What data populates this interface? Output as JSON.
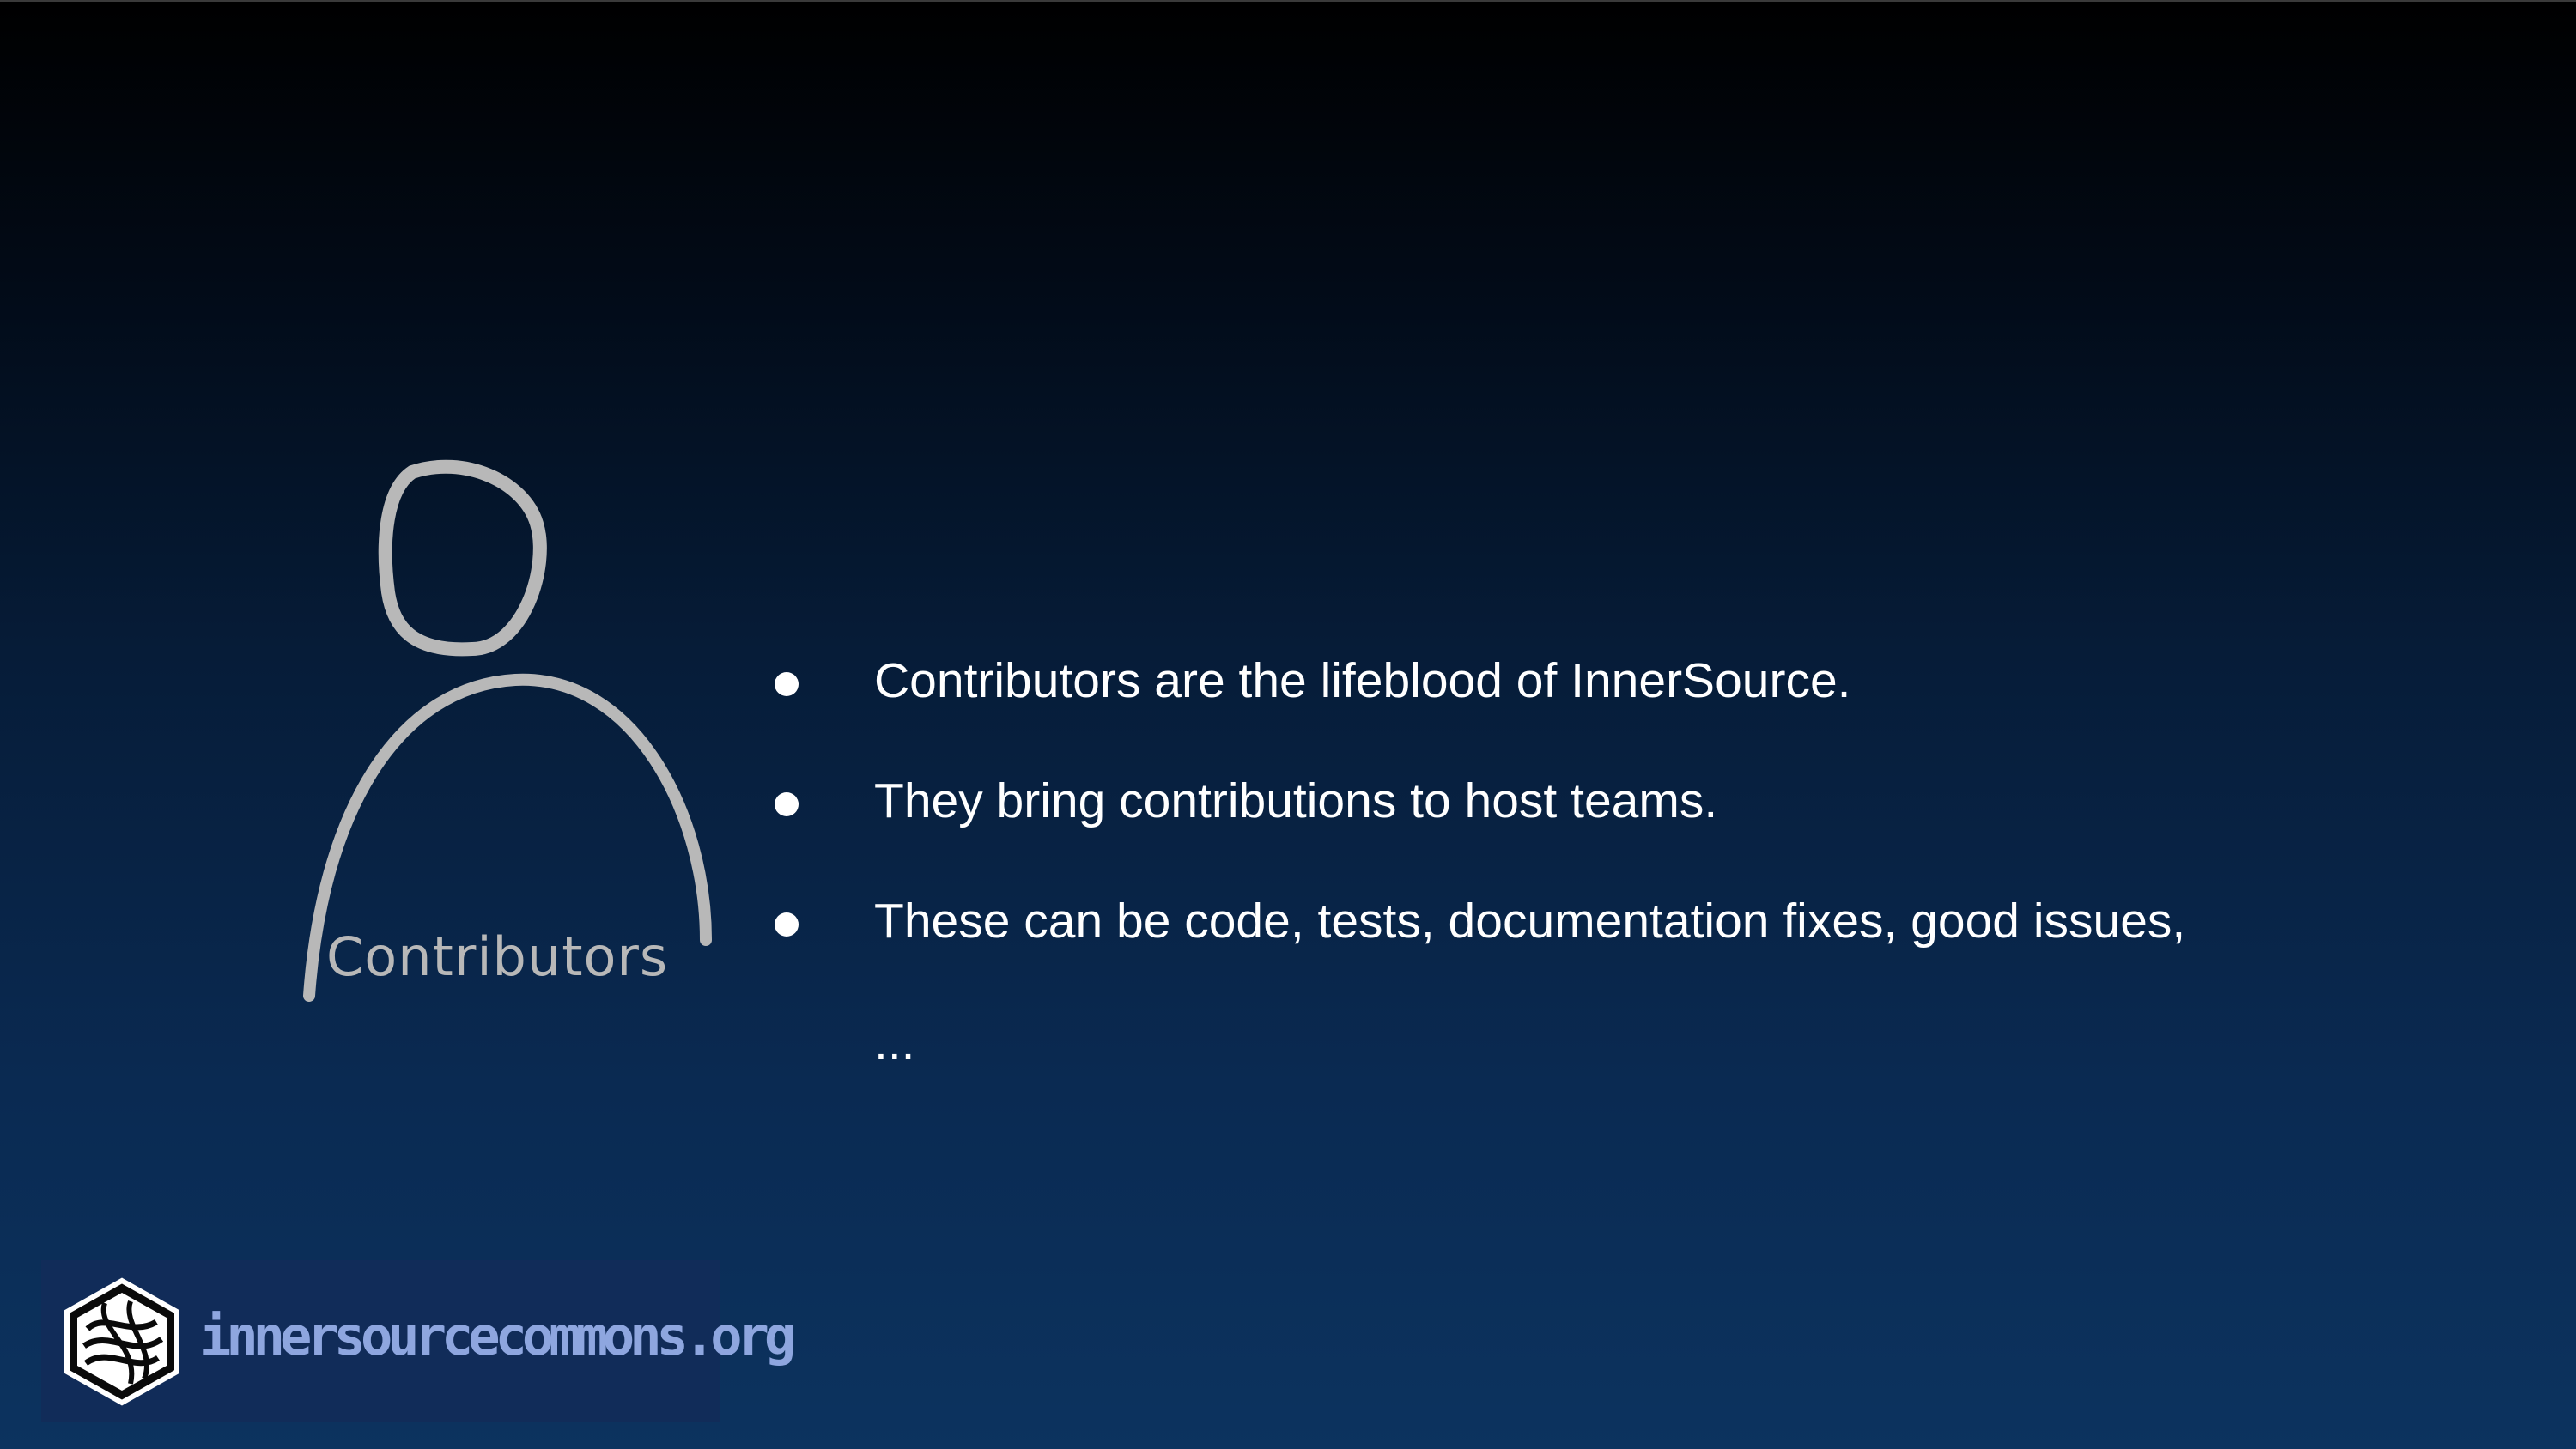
{
  "figure": {
    "label": "Contributors",
    "icon": "person-outline-icon"
  },
  "bullets": [
    "Contributors are the lifeblood of InnerSource.",
    "They bring contributions to host teams.",
    "These can be code, tests, documentation fixes, good issues,",
    "..."
  ],
  "logo": {
    "text": "innersourcecommons.org",
    "icon": "innersource-commons-hexagon-logo"
  },
  "colors": {
    "background_top": "#000000",
    "background_bottom": "#0c335f",
    "text": "#ffffff",
    "figure_stroke": "#b8b8b8",
    "logo_text": "#8ea6df"
  }
}
